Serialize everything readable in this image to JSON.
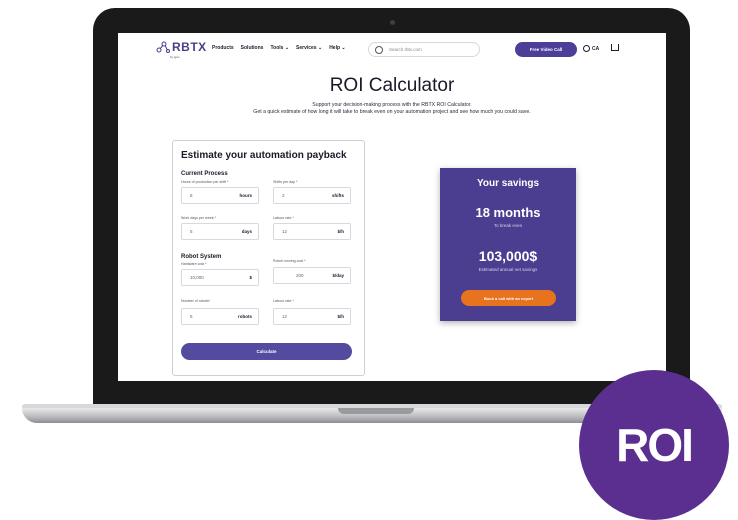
{
  "nav": {
    "logo": "RBTX",
    "logo_sub": "by igus",
    "menu": [
      "Products",
      "Solutions",
      "Tools",
      "Services",
      "Help"
    ],
    "search_placeholder": "Search rbtx.com",
    "video_call": "Free Video Call",
    "lang": "CA"
  },
  "hero": {
    "title": "ROI Calculator",
    "subtitle_line1": "Support your decision-making process with the RBTX ROI Calculator.",
    "subtitle_line2": "Get a quick estimate of how long it will take to break even on your automation project and see how much you could save."
  },
  "form": {
    "title": "Estimate your automation payback",
    "current_process": "Current Process",
    "hours_label": "Hours of production per shift *",
    "hours_value": "8",
    "hours_unit": "hours",
    "shifts_label": "Shifts per day *",
    "shifts_value": "2",
    "shifts_unit": "shifts",
    "workdays_label": "Work days per week *",
    "workdays_value": "5",
    "workdays_unit": "days",
    "labour_label": "Labour rate *",
    "labour_value": "12",
    "labour_unit": "$/h",
    "robot_system": "Robot System",
    "hardware_label": "Hardware cost *",
    "hardware_value": "10,000",
    "hardware_unit": "$",
    "running_label": "Robot running cost *",
    "running_value": "200",
    "running_unit": "$/day",
    "robots_label": "Number of robots*",
    "robots_value": "5",
    "robots_unit": "robots",
    "labour2_label": "Labour rate *",
    "labour2_value": "12",
    "labour2_unit": "$/h",
    "calculate": "Calculate"
  },
  "savings": {
    "title": "Your savings",
    "months": "18 months",
    "break_even": "To break even",
    "amount": "103,000$",
    "annual": "Estimated annual net savings",
    "cta": "Book a call with an expert"
  },
  "badge": "ROI",
  "colors": {
    "brand_purple": "#4b3d8f",
    "cta_orange": "#e8731f",
    "badge_purple": "#5a2f8f"
  }
}
